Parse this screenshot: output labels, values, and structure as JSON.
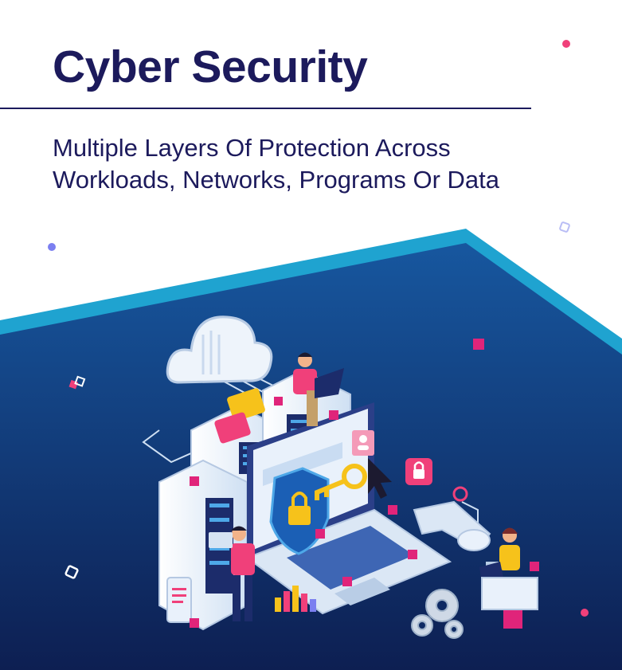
{
  "header": {
    "title": "Cyber Security",
    "subtitle_line1": "Multiple Layers Of Protection Across",
    "subtitle_line2": "Workloads, Networks, Programs Or Data"
  },
  "colors": {
    "title": "#1c1a5c",
    "panel_dark": "#0f2a63",
    "panel_mid": "#16509a",
    "panel_edge": "#1fa3d0",
    "accent_pink": "#f0407a",
    "accent_magenta": "#e0247a",
    "accent_yellow": "#f6c21b",
    "accent_purple": "#7b7ff0"
  },
  "illustration": {
    "icons": [
      "cloud-icon",
      "server-rack-icon",
      "shield-lock-icon",
      "key-icon",
      "padlock-icon",
      "cursor-icon",
      "laptop-icon",
      "gear-icon",
      "chat-bubble-icon",
      "user-profile-icon",
      "phone-icon",
      "bar-chart-icon"
    ]
  }
}
